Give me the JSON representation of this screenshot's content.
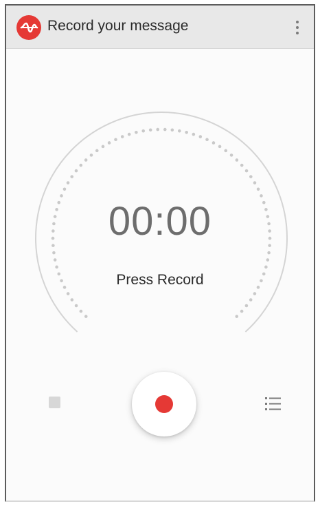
{
  "app_bar": {
    "title": "Record your message",
    "app_icon": "soundwave-icon",
    "menu_icon": "more-vert-icon"
  },
  "recorder": {
    "timer": "00:00",
    "status": "Press Record"
  },
  "controls": {
    "stop_icon": "stop-icon",
    "record_icon": "record-icon",
    "list_icon": "recordings-list-icon"
  },
  "colors": {
    "accent": "#e53935",
    "app_bar": "#e8e8e8",
    "background": "#fbfbfb",
    "timer_text": "#6d6d6d",
    "dial_ring": "#d4d4d4",
    "dial_dots": "#c9c9c9"
  }
}
